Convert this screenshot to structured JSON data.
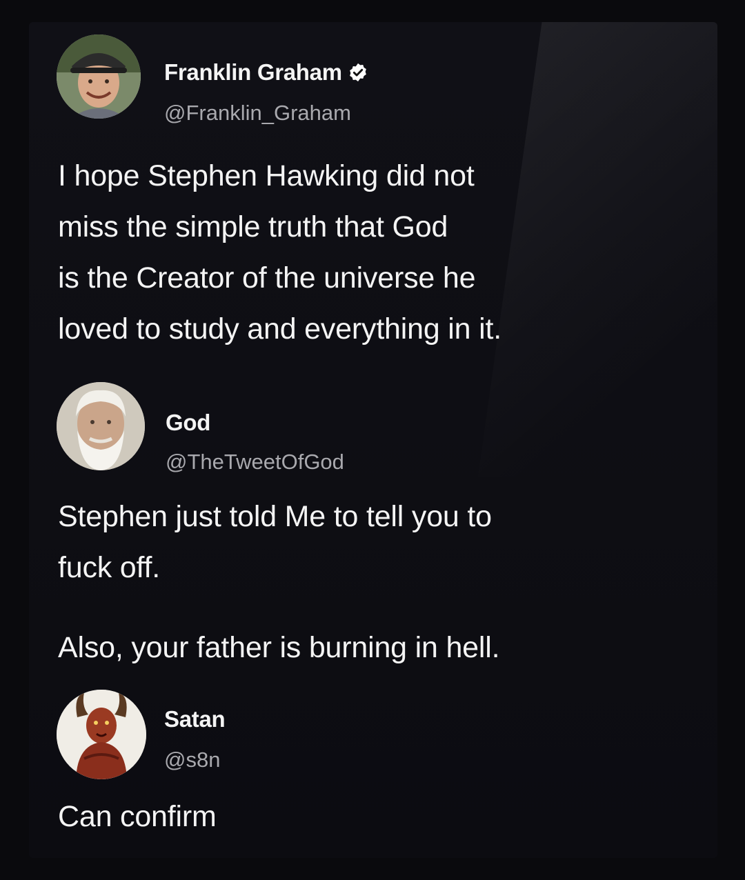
{
  "tweets": [
    {
      "name": "Franklin Graham",
      "handle": "@Franklin_Graham",
      "verified": true,
      "avatar_icon": "avatar-franklin-graham",
      "lines": [
        "I hope Stephen Hawking did not",
        "miss the simple truth that God",
        "is the Creator of the universe he",
        "loved to study and everything in it."
      ]
    },
    {
      "name": "God",
      "handle": "@TheTweetOfGod",
      "verified": false,
      "avatar_icon": "avatar-god",
      "lines": [
        "Stephen just told Me to tell you to",
        "fuck off."
      ],
      "lines2": [
        "Also, your father is burning in hell."
      ]
    },
    {
      "name": "Satan",
      "handle": "@s8n",
      "verified": false,
      "avatar_icon": "avatar-satan",
      "lines": [
        "Can confirm"
      ]
    }
  ],
  "colors": {
    "background": "#0c0c11",
    "text": "#f4f4f4",
    "handle": "#a9a9ae",
    "verified_badge": "#ffffff"
  }
}
